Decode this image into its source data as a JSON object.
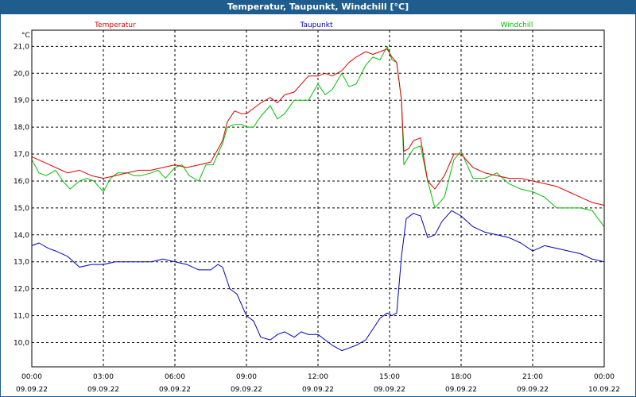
{
  "window": {
    "title": "Temperatur, Taupunkt, Windchill [°C]"
  },
  "colors": {
    "titlebar": "#1f5d8f",
    "temperatur": "#e00000",
    "taupunkt": "#0000c0",
    "windchill": "#00c000",
    "grid": "#000000"
  },
  "chart_data": {
    "type": "line",
    "title": "Temperatur, Taupunkt, Windchill [°C]",
    "ylabel": "°C",
    "xlabel": "",
    "xlim": [
      0,
      24
    ],
    "ylim": [
      9.1,
      21.6
    ],
    "grid": true,
    "legend": "top",
    "yticks": [
      "10,0",
      "11,0",
      "12,0",
      "13,0",
      "14,0",
      "15,0",
      "16,0",
      "17,0",
      "18,0",
      "19,0",
      "20,0",
      "21,0"
    ],
    "xticks": [
      {
        "time": "00:00",
        "date": "09.09.22"
      },
      {
        "time": "03:00",
        "date": "09.09.22"
      },
      {
        "time": "06:00",
        "date": "09.09.22"
      },
      {
        "time": "09:00",
        "date": "09.09.22"
      },
      {
        "time": "12:00",
        "date": "09.09.22"
      },
      {
        "time": "15:00",
        "date": "09.09.22"
      },
      {
        "time": "18:00",
        "date": "09.09.22"
      },
      {
        "time": "21:00",
        "date": "09.09.22"
      },
      {
        "time": "00:00",
        "date": "10.09.22"
      }
    ],
    "series": [
      {
        "name": "Temperatur",
        "color": "#e00000",
        "x": [
          0,
          0.5,
          1,
          1.5,
          2,
          2.5,
          3,
          3.5,
          4,
          4.5,
          5,
          5.5,
          6,
          6.5,
          7,
          7.5,
          8,
          8.2,
          8.5,
          8.8,
          9,
          9.3,
          9.6,
          10,
          10.3,
          10.6,
          11,
          11.3,
          11.6,
          12,
          12.3,
          12.6,
          13,
          13.3,
          13.6,
          14,
          14.3,
          14.6,
          14.9,
          15.1,
          15.3,
          15.5,
          15.6,
          15.8,
          16,
          16.3,
          16.6,
          16.9,
          17.3,
          17.7,
          18,
          18.5,
          19,
          19.5,
          20,
          20.5,
          21,
          21.5,
          22,
          22.5,
          23,
          23.5,
          24
        ],
        "values": [
          16.9,
          16.7,
          16.5,
          16.3,
          16.4,
          16.2,
          16.1,
          16.2,
          16.3,
          16.4,
          16.4,
          16.5,
          16.6,
          16.5,
          16.6,
          16.7,
          17.5,
          18.2,
          18.6,
          18.5,
          18.5,
          18.7,
          18.9,
          19.1,
          18.9,
          19.2,
          19.3,
          19.6,
          19.9,
          19.9,
          20.0,
          19.9,
          20.1,
          20.4,
          20.6,
          20.8,
          20.7,
          20.8,
          20.9,
          20.6,
          20.4,
          19.0,
          17.1,
          17.2,
          17.5,
          17.6,
          16.0,
          15.7,
          16.2,
          17.0,
          17.0,
          16.5,
          16.3,
          16.2,
          16.1,
          16.1,
          16.0,
          15.9,
          15.8,
          15.6,
          15.4,
          15.2,
          15.1
        ]
      },
      {
        "name": "Taupunkt",
        "color": "#0000c0",
        "x": [
          0,
          0.3,
          0.7,
          1,
          1.5,
          2,
          2.5,
          3,
          3.5,
          4,
          4.5,
          5,
          5.5,
          6,
          6.5,
          7,
          7.5,
          7.8,
          8,
          8.3,
          8.6,
          9,
          9.3,
          9.6,
          10,
          10.3,
          10.6,
          11,
          11.3,
          11.6,
          12,
          12.3,
          12.6,
          13,
          13.3,
          13.6,
          14,
          14.3,
          14.6,
          14.9,
          15.1,
          15.3,
          15.5,
          15.7,
          16,
          16.3,
          16.6,
          16.9,
          17.2,
          17.6,
          18,
          18.5,
          19,
          19.5,
          20,
          20.5,
          21,
          21.5,
          22,
          22.5,
          23,
          23.5,
          24
        ],
        "values": [
          13.6,
          13.7,
          13.5,
          13.4,
          13.2,
          12.8,
          12.9,
          12.9,
          13.0,
          13.0,
          13.0,
          13.0,
          13.1,
          13.0,
          12.9,
          12.7,
          12.7,
          12.9,
          12.8,
          12.0,
          11.8,
          11.0,
          10.8,
          10.2,
          10.1,
          10.3,
          10.4,
          10.2,
          10.4,
          10.3,
          10.3,
          10.1,
          9.9,
          9.7,
          9.8,
          9.9,
          10.1,
          10.5,
          10.9,
          11.1,
          11.0,
          11.1,
          13.2,
          14.6,
          14.8,
          14.7,
          13.9,
          14.0,
          14.5,
          14.9,
          14.7,
          14.3,
          14.1,
          14.0,
          13.9,
          13.7,
          13.4,
          13.6,
          13.5,
          13.4,
          13.3,
          13.1,
          13.0
        ]
      },
      {
        "name": "Windchill",
        "color": "#00c000",
        "x": [
          0,
          0.3,
          0.6,
          1,
          1.3,
          1.6,
          2,
          2.3,
          2.6,
          3,
          3.3,
          3.6,
          4,
          4.3,
          4.6,
          5,
          5.3,
          5.6,
          6,
          6.3,
          6.6,
          7,
          7.3,
          7.6,
          8,
          8.2,
          8.5,
          8.8,
          9,
          9.3,
          9.6,
          10,
          10.3,
          10.6,
          11,
          11.3,
          11.6,
          12,
          12.3,
          12.6,
          13,
          13.3,
          13.6,
          14,
          14.3,
          14.6,
          14.9,
          15.1,
          15.3,
          15.5,
          15.6,
          15.8,
          16,
          16.3,
          16.6,
          16.9,
          17.3,
          17.7,
          18,
          18.5,
          19,
          19.5,
          20,
          20.5,
          21,
          21.5,
          22,
          22.5,
          23,
          23.5,
          24
        ],
        "values": [
          16.8,
          16.3,
          16.2,
          16.4,
          16.0,
          15.7,
          16.0,
          16.1,
          16.0,
          15.6,
          16.1,
          16.3,
          16.3,
          16.2,
          16.2,
          16.3,
          16.4,
          16.1,
          16.5,
          16.6,
          16.2,
          16.0,
          16.6,
          16.6,
          17.4,
          18.0,
          18.1,
          18.1,
          18.0,
          18.0,
          18.4,
          18.8,
          18.3,
          18.5,
          19.0,
          19.0,
          19.0,
          19.6,
          19.2,
          19.4,
          20.0,
          19.5,
          19.6,
          20.3,
          20.6,
          20.5,
          21.0,
          20.5,
          20.4,
          19.0,
          16.6,
          16.9,
          17.2,
          17.3,
          16.0,
          15.0,
          15.4,
          16.8,
          17.1,
          16.1,
          16.1,
          16.3,
          15.9,
          15.7,
          15.6,
          15.4,
          15.0,
          15.0,
          15.0,
          14.9,
          14.3
        ]
      }
    ]
  }
}
